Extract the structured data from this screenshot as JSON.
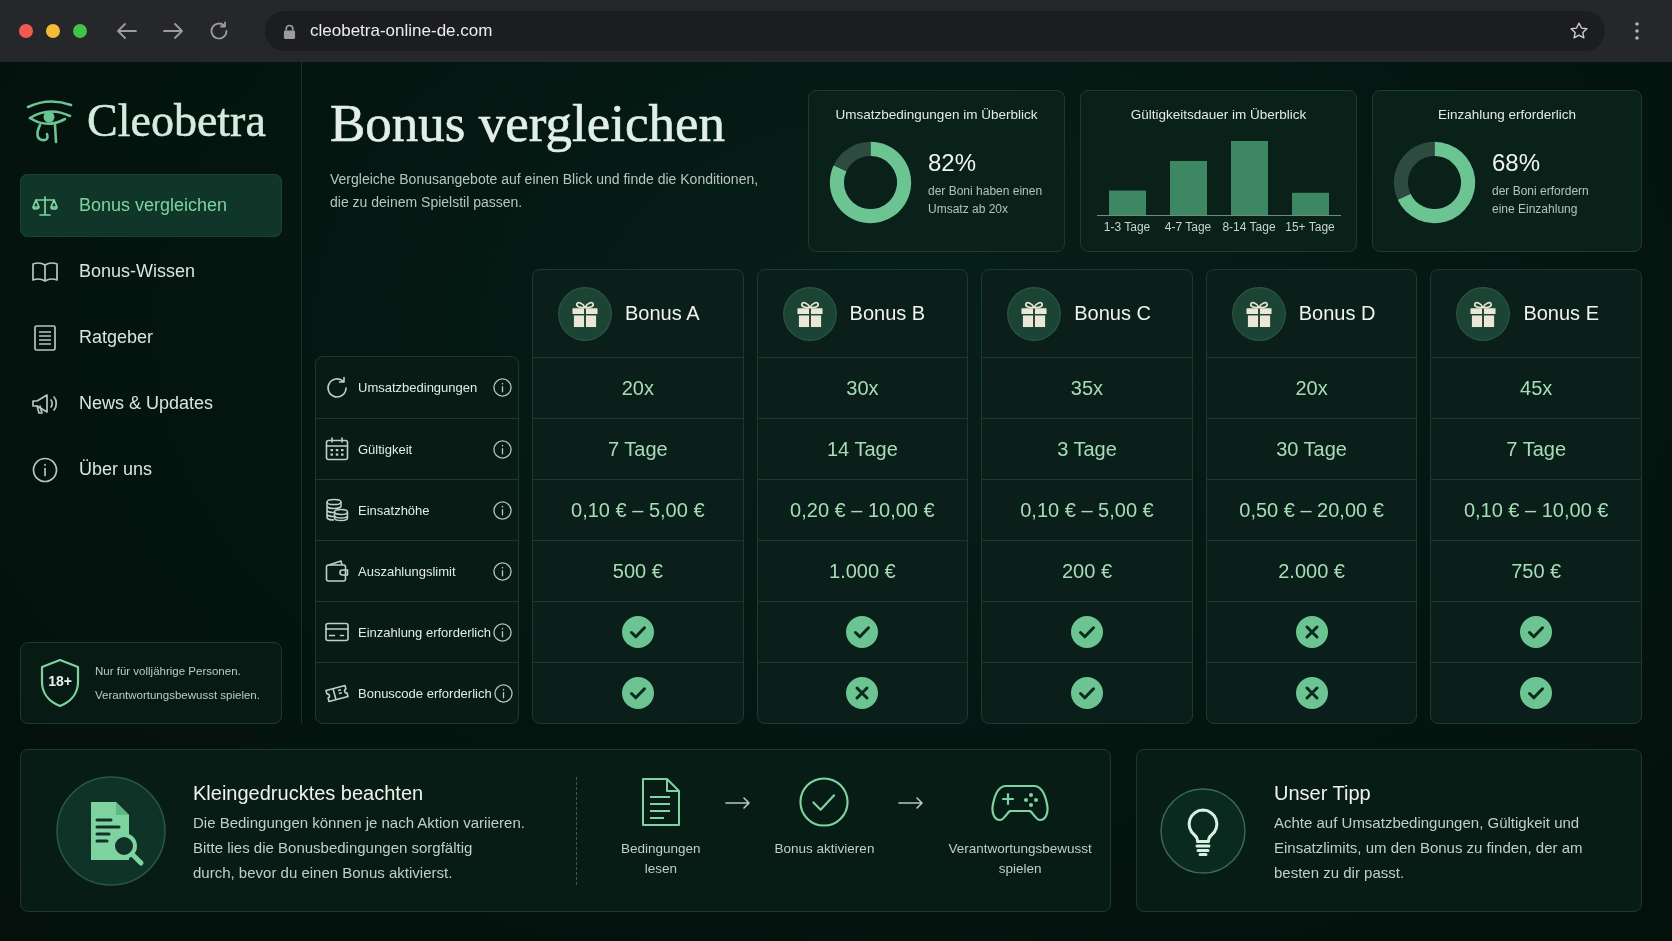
{
  "browser": {
    "url": "cleobetra-online-de.com"
  },
  "sidebar": {
    "brand": "Cleobetra",
    "nav": [
      {
        "label": "Bonus vergleichen",
        "selected": true
      },
      {
        "label": "Bonus-Wissen",
        "selected": false
      },
      {
        "label": "Ratgeber",
        "selected": false
      },
      {
        "label": "News & Updates",
        "selected": false
      },
      {
        "label": "Über uns",
        "selected": false
      }
    ],
    "age_notice": {
      "badge": "18+",
      "text": "Nur für volljährige Personen.\nVerantwortungsbewusst spielen."
    }
  },
  "header": {
    "title": "Bonus vergleichen",
    "subtitle": "Vergleiche Bonusangebote auf einen Blick und finde die Konditionen,\ndie zu deinem Spielstil passen."
  },
  "stats": [
    {
      "kind": "donut",
      "title": "Umsatzbedingungen im Überblick",
      "value": "82%",
      "caption": "der Boni haben einen\nUmsatz ab 20x",
      "chart_data": {
        "type": "donut",
        "values": [
          82,
          18
        ]
      }
    },
    {
      "kind": "bar",
      "title": "Gültigkeitsdauer im Überblick",
      "bar_labels": [
        "1-3 Tage",
        "4-7 Tage",
        "8-14 Tage",
        "15+ Tage"
      ]
    },
    {
      "kind": "donut",
      "title": "Einzahlung erforderlich",
      "value": "68%",
      "caption": "der Boni erfordern\neine Einzahlung",
      "chart_data": {
        "type": "donut",
        "values": [
          68,
          32
        ]
      }
    }
  ],
  "comparison": {
    "bonuses": [
      {
        "name": "Bonus A"
      },
      {
        "name": "Bonus B"
      },
      {
        "name": "Bonus C"
      },
      {
        "name": "Bonus D"
      },
      {
        "name": "Bonus E"
      }
    ],
    "rows": [
      {
        "label": "Umsatzbedingungen",
        "kind": "text",
        "cells": [
          {
            "text": "20x"
          },
          {
            "text": "30x"
          },
          {
            "text": "35x"
          },
          {
            "text": "20x"
          },
          {
            "text": "45x"
          }
        ]
      },
      {
        "label": "Gültigkeit",
        "kind": "text",
        "cells": [
          {
            "text": "7 Tage"
          },
          {
            "text": "14 Tage"
          },
          {
            "text": "3 Tage"
          },
          {
            "text": "30 Tage"
          },
          {
            "text": "7 Tage"
          }
        ]
      },
      {
        "label": "Einsatzhöhe",
        "kind": "text",
        "cells": [
          {
            "text": "0,10 € – 5,00 €"
          },
          {
            "text": "0,20 € – 10,00 €"
          },
          {
            "text": "0,10 € – 5,00 €"
          },
          {
            "text": "0,50 € – 20,00 €"
          },
          {
            "text": "0,10 € – 10,00 €"
          }
        ]
      },
      {
        "label": "Auszahlungslimit",
        "kind": "text",
        "cells": [
          {
            "text": "500 €"
          },
          {
            "text": "1.000 €"
          },
          {
            "text": "200 €"
          },
          {
            "text": "2.000 €"
          },
          {
            "text": "750 €"
          }
        ]
      },
      {
        "label": "Einzahlung erforderlich",
        "kind": "flag",
        "cells": [
          {
            "checked": true
          },
          {
            "checked": true
          },
          {
            "checked": true
          },
          {
            "checked": false
          },
          {
            "checked": true
          }
        ]
      },
      {
        "label": "Bonuscode erforderlich",
        "kind": "flag",
        "cells": [
          {
            "checked": true
          },
          {
            "checked": false
          },
          {
            "checked": true
          },
          {
            "checked": false
          },
          {
            "checked": true
          }
        ]
      }
    ]
  },
  "fine_print": {
    "title": "Kleingedrucktes beachten",
    "text": "Die Bedingungen können je nach Aktion variieren.\nBitte lies die Bonusbedingungen sorgfältig\ndurch, bevor du einen Bonus aktivierst.",
    "steps": [
      {
        "label": "Bedingungen\nlesen"
      },
      {
        "label": "Bonus aktivieren"
      },
      {
        "label": "Verantwortungsbewusst\nspielen"
      }
    ]
  },
  "tip": {
    "title": "Unser Tipp",
    "text": "Achte auf Umsatzbedingungen, Gültigkeit und\nEinsatzlimits, um den Bonus zu finden, der am\nbesten zu dir passt."
  }
}
